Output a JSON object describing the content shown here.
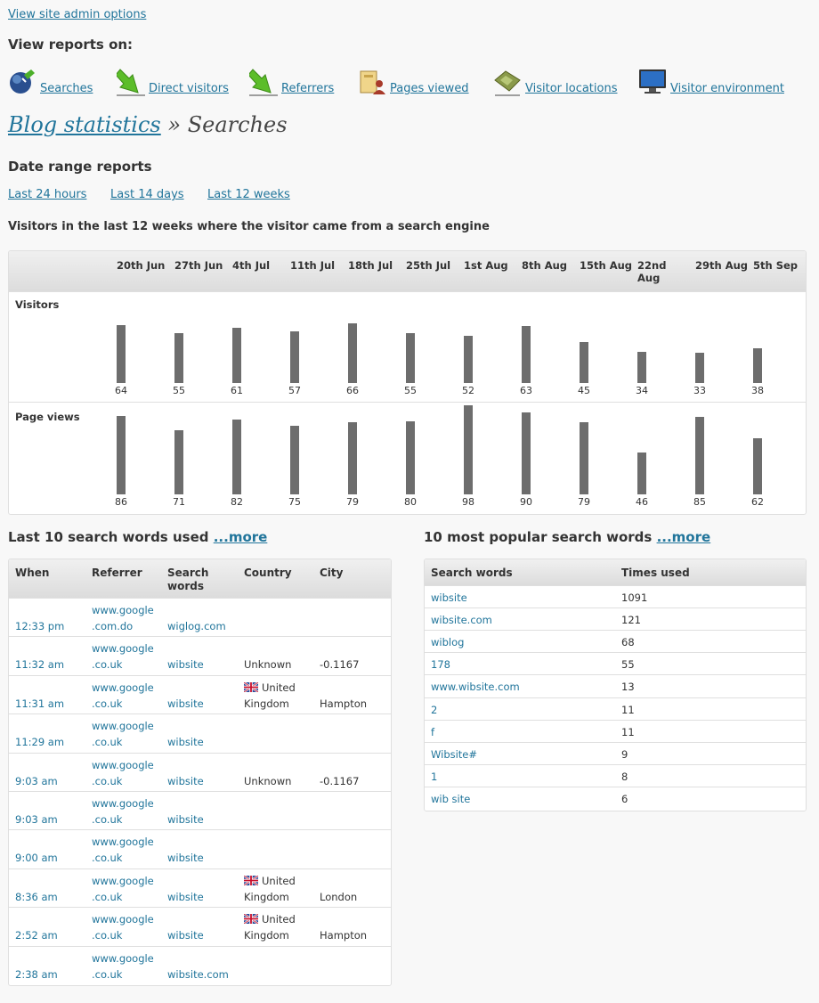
{
  "admin_link": "View site admin options",
  "view_reports_heading": "View reports on:",
  "nav": [
    {
      "label": "Searches",
      "icon": "globe-search-icon"
    },
    {
      "label": "Direct visitors",
      "icon": "green-arrow-icon"
    },
    {
      "label": "Referrers",
      "icon": "green-arrow-icon"
    },
    {
      "label": "Pages viewed",
      "icon": "pages-viewed-icon"
    },
    {
      "label": "Visitor locations",
      "icon": "map-icon"
    },
    {
      "label": "Visitor environment",
      "icon": "monitor-icon"
    }
  ],
  "title": {
    "link": "Blog statistics",
    "rest": "» Searches"
  },
  "date_range": {
    "heading": "Date range reports",
    "links": [
      "Last 24 hours",
      "Last 14 days",
      "Last 12 weeks"
    ]
  },
  "chart_heading": "Visitors in the last 12 weeks where the visitor came from a search engine",
  "chart_data": {
    "type": "bar",
    "categories": [
      "20th Jun",
      "27th Jun",
      "4th Jul",
      "11th Jul",
      "18th Jul",
      "25th Jul",
      "1st Aug",
      "8th Aug",
      "15th Aug",
      "22nd Aug",
      "29th Aug",
      "5th Sep"
    ],
    "series": [
      {
        "name": "Visitors",
        "values": [
          64,
          55,
          61,
          57,
          66,
          55,
          52,
          63,
          45,
          34,
          33,
          38
        ]
      },
      {
        "name": "Page views",
        "values": [
          86,
          71,
          82,
          75,
          79,
          80,
          98,
          90,
          79,
          46,
          85,
          62
        ]
      }
    ],
    "bar_color": "#6d6d6d"
  },
  "last_searches": {
    "heading": "Last 10 search words used",
    "more": "...more",
    "columns": [
      "When",
      "Referrer",
      "Search words",
      "Country",
      "City"
    ],
    "rows": [
      {
        "when": "12:33 pm",
        "ref1": "www.google",
        "ref2": ".com.do",
        "words": "wiglog.com",
        "country1": "",
        "country2": "",
        "flag": false,
        "city": ""
      },
      {
        "when": "11:32 am",
        "ref1": "www.google",
        "ref2": ".co.uk",
        "words": "wibsite",
        "country1": "",
        "country2": "Unknown",
        "flag": false,
        "city": "-0.1167"
      },
      {
        "when": "11:31 am",
        "ref1": "www.google",
        "ref2": ".co.uk",
        "words": "wibsite",
        "country1": "United",
        "country2": "Kingdom",
        "flag": true,
        "city": "Hampton"
      },
      {
        "when": "11:29 am",
        "ref1": "www.google",
        "ref2": ".co.uk",
        "words": "wibsite",
        "country1": "",
        "country2": "",
        "flag": false,
        "city": ""
      },
      {
        "when": "9:03 am",
        "ref1": "www.google",
        "ref2": ".co.uk",
        "words": "wibsite",
        "country1": "",
        "country2": "Unknown",
        "flag": false,
        "city": "-0.1167"
      },
      {
        "when": "9:03 am",
        "ref1": "www.google",
        "ref2": ".co.uk",
        "words": "wibsite",
        "country1": "",
        "country2": "",
        "flag": false,
        "city": ""
      },
      {
        "when": "9:00 am",
        "ref1": "www.google",
        "ref2": ".co.uk",
        "words": "wibsite",
        "country1": "",
        "country2": "",
        "flag": false,
        "city": ""
      },
      {
        "when": "8:36 am",
        "ref1": "www.google",
        "ref2": ".co.uk",
        "words": "wibsite",
        "country1": "United",
        "country2": "Kingdom",
        "flag": true,
        "city": "London"
      },
      {
        "when": "2:52 am",
        "ref1": "www.google",
        "ref2": ".co.uk",
        "words": "wibsite",
        "country1": "United",
        "country2": "Kingdom",
        "flag": true,
        "city": "Hampton"
      },
      {
        "when": "2:38 am",
        "ref1": "www.google",
        "ref2": ".co.uk",
        "words": "wibsite.com",
        "country1": "",
        "country2": "",
        "flag": false,
        "city": ""
      }
    ]
  },
  "popular_searches": {
    "heading": "10 most popular search words",
    "more": "...more",
    "columns": [
      "Search words",
      "Times used"
    ],
    "rows": [
      {
        "word": "wibsite",
        "count": "1091"
      },
      {
        "word": "wibsite.com",
        "count": "121"
      },
      {
        "word": "wiblog",
        "count": "68"
      },
      {
        "word": "178",
        "count": "55"
      },
      {
        "word": "www.wibsite.com",
        "count": "13"
      },
      {
        "word": "2",
        "count": "11"
      },
      {
        "word": "f",
        "count": "11"
      },
      {
        "word": "Wibsite#",
        "count": "9"
      },
      {
        "word": "1",
        "count": "8"
      },
      {
        "word": "wib site",
        "count": "6"
      }
    ]
  }
}
